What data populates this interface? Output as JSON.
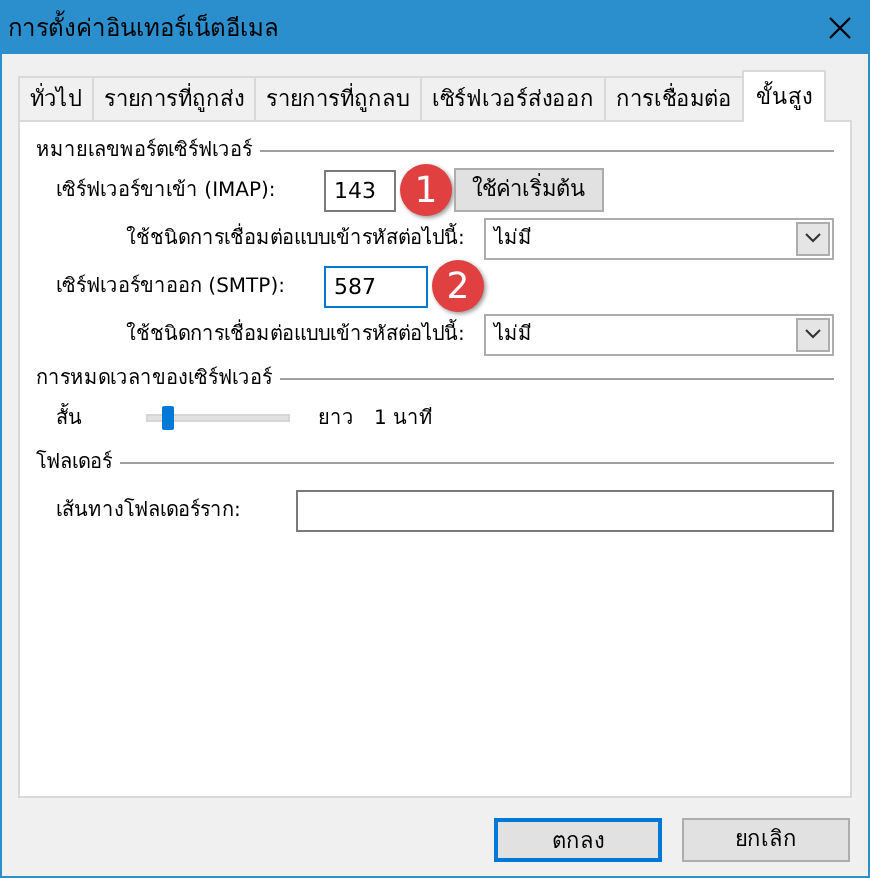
{
  "window": {
    "title": "การตั้งค่าอินเทอร์เน็ตอีเมล"
  },
  "tabs": [
    {
      "label": "ทั่วไป",
      "selected": false
    },
    {
      "label": "รายการที่ถูกส่ง",
      "selected": false
    },
    {
      "label": "รายการที่ถูกลบ",
      "selected": false
    },
    {
      "label": "เซิร์ฟเวอร์ส่งออก",
      "selected": false
    },
    {
      "label": "การเชื่อมต่อ",
      "selected": false
    },
    {
      "label": "ขั้นสูง",
      "selected": true
    }
  ],
  "server_ports": {
    "title": "หมายเลขพอร์ตเซิร์ฟเวอร์",
    "rows": [
      {
        "kind": "port",
        "label": "เซิร์ฟเวอร์ขาเข้า (IMAP):",
        "value": "143",
        "focused": false,
        "badge": "1",
        "button": "ใช้ค่าเริ่มต้น"
      },
      {
        "kind": "select",
        "label": "ใช้ชนิดการเชื่อมต่อแบบเข้ารหัสต่อไปนี้:",
        "value": "ไม่มี"
      },
      {
        "kind": "port",
        "label": "เซิร์ฟเวอร์ขาออก (SMTP):",
        "value": "587",
        "focused": true,
        "badge": "2"
      },
      {
        "kind": "select",
        "label": "ใช้ชนิดการเชื่อมต่อแบบเข้ารหัสต่อไปนี้:",
        "value": "ไม่มี"
      }
    ]
  },
  "timeout": {
    "title": "การหมดเวลาของเซิร์ฟเวอร์",
    "short_label": "สั้น",
    "level": 0.1,
    "long_label": "ยาว",
    "reading": "1 นาที"
  },
  "folders": {
    "title": "โฟลเดอร์",
    "root_label": "เส้นทางโฟลเดอร์ราก:"
  },
  "buttons": [
    {
      "label": "ตกลง",
      "default": true
    },
    {
      "label": "ยกเลิก",
      "default": false
    }
  ]
}
